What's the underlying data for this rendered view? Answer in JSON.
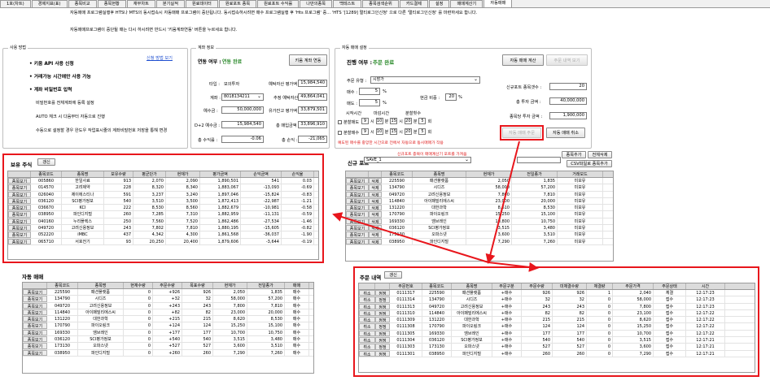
{
  "tabs": [
    "1호(차트)",
    "경제지표(표)",
    "종목비교",
    "종목현황",
    "재무차트",
    "분기실적",
    "원료데이터",
    "원료포트 종목",
    "원료포트 수익률",
    "나만의종목",
    "백테스트",
    "종목검색순위",
    "카드결제",
    "설정",
    "매매계산기",
    "자동매매"
  ],
  "notice": {
    "line1": "자동매매 프로그램실행후 HTS나 MTS의 동시접속시 자동매매 프로그램이 중단됩니다. 동시접속하시려면 매수 프로그램실행 후 'Hts 프로그램' 중... 'HTS '[1289] 멀티로그인신청' 으로 다른 '멀티로그인신청' 를 마련하세요 합니다.",
    "line2": "자동매매프로그램이 중단될 때는 다시 하시려면 반드시 '키움계좌연동' 버튼을 누르세요 합니다."
  },
  "usage": {
    "title": "사용 방법",
    "guide_link": "신청 방법 보기",
    "step1": "• 키움 API 사용 신청",
    "step2": "• 거래가능 시간에만 사용 가능",
    "step3": "• 계좌 비밀번호 입력",
    "desc1": "비밀번호를 전체계좌에 등록 설정",
    "desc2": "AUTO 체크 시 다음부터 자동으로 진행",
    "desc3": "수동으로 설정할 경우 완도우 작업표시줄의 계좌비밀번호 저장을 통해 변경"
  },
  "account": {
    "title": "계좌 정보",
    "link_label": "연동 여부 :",
    "link_status": "연동 완료",
    "link_button": "키움 계좌 연동",
    "type_label": "타입 :",
    "type_value": "모의투자",
    "account_label": "계좌 :",
    "account_value": "8018134211",
    "deposit_label": "예수금 :",
    "deposit_value": "50,000,000",
    "d2_label": "D+2 예수금 :",
    "d2_value": "15,984,540",
    "total_rate_label": "총 수익률 :",
    "total_rate_value": "-0.06",
    "eval_total_label": "예탁자산 평가액 :",
    "eval_total_value": "15,984,540",
    "est_asset_label": "추정 예탁자산 :",
    "est_asset_value": "49,864,041",
    "stock_eval_label": "유가잔고 평가액 :",
    "stock_eval_value": "33,879,501",
    "buy_total_label": "총 매입금액 :",
    "buy_total_value": "33,896,910",
    "pnl_label": "총 손익 :",
    "pnl_value": "-21,065"
  },
  "autotrade": {
    "title": "자동 매매 설정",
    "run_label": "진행 여부 :",
    "run_status": "주문 완료",
    "calc_button": "자동 매매 계산",
    "confirm_button": "주문 내역 보기",
    "order_type_label": "주문 유형 :",
    "order_type_value": "시장가",
    "buy_label": "매수 :",
    "buy_value": "5",
    "sell_label": "매도 :",
    "sell_value": "5",
    "cash_label": "현금 비중 :",
    "cash_value": "20",
    "pct": "%",
    "new_count_label": "신규포트 종목갯수 :",
    "new_count_value": "20",
    "total_invest_label": "총 투자 금액 :",
    "total_invest_value": "40,000,000",
    "per_stock_label": "종목당 투자 금액 :",
    "per_stock_value": "1,900,000",
    "start_time": "시작시간",
    "end_time": "마감시간",
    "split_count": "분할횟수",
    "split_buy": "분할매도",
    "split_sell": "분할매수",
    "sh": "9",
    "sm": "10",
    "eh": "15",
    "em": "20",
    "cnt": "5",
    "hour": "시",
    "minute": "분",
    "times": "회",
    "warning": "예도된 매수를 중앙한 시간으로 전에서 자동으로 동시매매가 작용",
    "start_button": "자동 매매 주문",
    "cancel_button": "자동 매매 취소"
  },
  "holdings": {
    "title": "보유 주식",
    "refresh": "갱신",
    "columns": [
      "",
      "종목코드",
      "종목명",
      "보유수량",
      "평균단가",
      "현재가",
      "평가금액",
      "손익금액",
      "손익율"
    ],
    "rows": [
      [
        "종목보기",
        "005860",
        "한일사료",
        "913",
        "2,070",
        "2,090",
        "1,890,501",
        "541",
        "0.03"
      ],
      [
        "종목보기",
        "014570",
        "고려제약",
        "228",
        "8,320",
        "8,340",
        "1,883,067",
        "-13,093",
        "-0.69"
      ],
      [
        "종목보기",
        "026040",
        "제이에스티나",
        "591",
        "3,237",
        "3,240",
        "1,897,046",
        "-15,824",
        "-0.83"
      ],
      [
        "종목보기",
        "036120",
        "SCI평가정보",
        "540",
        "3,510",
        "3,500",
        "1,872,413",
        "-22,987",
        "-1.21"
      ],
      [
        "종목보기",
        "036670",
        "KCI",
        "222",
        "8,530",
        "8,560",
        "1,882,679",
        "-10,981",
        "-0.58"
      ],
      [
        "종목보기",
        "038950",
        "파인디지털",
        "260",
        "7,285",
        "7,310",
        "1,882,959",
        "-11,131",
        "-0.59"
      ],
      [
        "종목보기",
        "040160",
        "누리플렉스",
        "250",
        "7,560",
        "7,520",
        "1,862,486",
        "-27,534",
        "-1.46"
      ],
      [
        "종목보기",
        "049720",
        "고려신용정보",
        "243",
        "7,802",
        "7,810",
        "1,880,195",
        "-15,605",
        "-0.82"
      ],
      [
        "종목보기",
        "052220",
        "iMBC",
        "437",
        "4,342",
        "4,300",
        "1,861,568",
        "-36,037",
        "-1.90"
      ],
      [
        "종목보기",
        "065710",
        "서호전기",
        "93",
        "20,250",
        "20,400",
        "1,879,606",
        "-3,644",
        "-0.19"
      ]
    ]
  },
  "newport": {
    "title": "신규 포트",
    "select_value": "SAVE_1",
    "hint": "신규포트 종목이 매매계산기 포트를 가져옴",
    "add_button": "종목추가",
    "clear_button": "전체삭제",
    "csv_button": "CSV파일로 종목추가",
    "columns": [
      "",
      "",
      "종목코드",
      "종목명",
      "현재가",
      "전일종가",
      "거래모드"
    ],
    "rows": [
      [
        "종목보기",
        "삭제",
        "225590",
        "패션플랫폼",
        "2,050",
        "1,835",
        "미보유"
      ],
      [
        "종목보기",
        "삭제",
        "134790",
        "시디즈",
        "58,000",
        "57,200",
        "미보유"
      ],
      [
        "종목보기",
        "삭제",
        "049720",
        "고려신용정보",
        "7,800",
        "7,810",
        "미보유"
      ],
      [
        "종목보기",
        "삭제",
        "114840",
        "아이패밀리에스씨",
        "23,000",
        "20,000",
        "미보유"
      ],
      [
        "종목보기",
        "삭제",
        "131220",
        "대한과학",
        "8,610",
        "8,530",
        "미보유"
      ],
      [
        "종목보기",
        "삭제",
        "170790",
        "파이오링크",
        "15,250",
        "15,100",
        "미보유"
      ],
      [
        "종목보기",
        "삭제",
        "169330",
        "엠브레인",
        "10,800",
        "10,750",
        "미보유"
      ],
      [
        "종목보기",
        "삭제",
        "036120",
        "SCI평가정보",
        "3,515",
        "3,480",
        "미보유"
      ],
      [
        "종목보기",
        "삭제",
        "173130",
        "오파스넷",
        "3,600",
        "3,510",
        "미보유"
      ],
      [
        "종목보기",
        "삭제",
        "038950",
        "파인디지털",
        "7,290",
        "7,260",
        "미보유"
      ]
    ]
  },
  "autotable": {
    "title": "자동 매매",
    "columns": [
      "",
      "종목코드",
      "종목명",
      "현재수량",
      "주문수량",
      "목표수량",
      "현재가",
      "전일종가",
      "매매"
    ],
    "rows": [
      [
        "종목보기",
        "225590",
        "패션플랫폼",
        "0",
        "+926",
        "926",
        "2,050",
        "1,835",
        "매수"
      ],
      [
        "종목보기",
        "134790",
        "시디즈",
        "0",
        "+32",
        "32",
        "58,000",
        "57,200",
        "매수"
      ],
      [
        "종목보기",
        "049720",
        "고려신용정보",
        "0",
        "+243",
        "243",
        "7,800",
        "7,810",
        "매수"
      ],
      [
        "종목보기",
        "114840",
        "아이패밀리에스씨",
        "0",
        "+82",
        "82",
        "23,000",
        "20,000",
        "매수"
      ],
      [
        "종목보기",
        "131220",
        "대한과학",
        "0",
        "+215",
        "215",
        "8,620",
        "8,530",
        "매수"
      ],
      [
        "종목보기",
        "170790",
        "파이오링크",
        "0",
        "+124",
        "124",
        "15,250",
        "15,100",
        "매수"
      ],
      [
        "종목보기",
        "169330",
        "엠브레인",
        "0",
        "+177",
        "177",
        "10,700",
        "10,750",
        "매수"
      ],
      [
        "종목보기",
        "036120",
        "SCI평가정보",
        "0",
        "+540",
        "540",
        "3,515",
        "3,480",
        "매수"
      ],
      [
        "종목보기",
        "173130",
        "오파스넷",
        "0",
        "+527",
        "527",
        "3,600",
        "3,510",
        "매수"
      ],
      [
        "종목보기",
        "038950",
        "파인디지털",
        "0",
        "+260",
        "260",
        "7,290",
        "7,260",
        "매수"
      ]
    ]
  },
  "orders": {
    "title": "주문 내역",
    "refresh": "갱신",
    "columns": [
      "",
      "",
      "주문번호",
      "종목코드",
      "종목명",
      "주문구분",
      "주문수량",
      "미체결수량",
      "체결량",
      "주문가격",
      "주문상태",
      "시간"
    ],
    "rows": [
      [
        "취소",
        "정정",
        "0111317",
        "225590",
        "패션플랫폼",
        "+매수",
        "926",
        "926",
        "1",
        "2,040",
        "체결",
        "12:17:23"
      ],
      [
        "취소",
        "정정",
        "0111314",
        "134790",
        "시디즈",
        "+매수",
        "32",
        "32",
        "0",
        "58,000",
        "접수",
        "12:17:23"
      ],
      [
        "취소",
        "정정",
        "0111313",
        "049720",
        "고려신용정보",
        "+매수",
        "243",
        "243",
        "0",
        "7,800",
        "접수",
        "12:17:23"
      ],
      [
        "취소",
        "정정",
        "0111310",
        "114840",
        "아이패밀리에스씨",
        "+매수",
        "82",
        "82",
        "0",
        "23,100",
        "접수",
        "12:17:22"
      ],
      [
        "취소",
        "정정",
        "0111309",
        "131220",
        "대한과학",
        "+매수",
        "215",
        "215",
        "0",
        "8,620",
        "접수",
        "12:17:22"
      ],
      [
        "취소",
        "정정",
        "0111308",
        "170790",
        "파이오링크",
        "+매수",
        "124",
        "124",
        "0",
        "15,250",
        "접수",
        "12:17:22"
      ],
      [
        "취소",
        "정정",
        "0111305",
        "169330",
        "엠브레인",
        "+매수",
        "177",
        "177",
        "0",
        "10,700",
        "접수",
        "12:17:22"
      ],
      [
        "취소",
        "정정",
        "0111304",
        "036120",
        "SCI평가정보",
        "+매수",
        "540",
        "540",
        "0",
        "3,515",
        "접수",
        "12:17:21"
      ],
      [
        "취소",
        "정정",
        "0111303",
        "173130",
        "오파스넷",
        "+매수",
        "527",
        "527",
        "0",
        "3,600",
        "접수",
        "12:17:21"
      ],
      [
        "취소",
        "정정",
        "0111301",
        "038950",
        "파인디지털",
        "+매수",
        "260",
        "260",
        "0",
        "7,290",
        "접수",
        "12:17:21"
      ]
    ]
  },
  "colors": {
    "highlight": "#e8161c",
    "linked": "#2b8a2b",
    "link": "#1f4fd0"
  }
}
